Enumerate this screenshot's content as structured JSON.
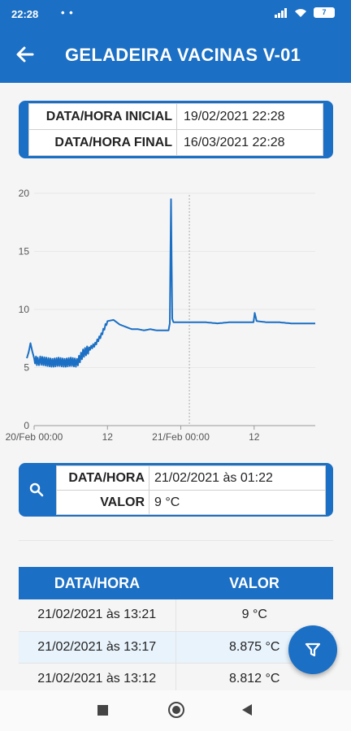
{
  "status": {
    "time": "22:28",
    "dots": "• •",
    "battery": "7"
  },
  "header": {
    "back_icon": "arrow-left-icon",
    "title": "GELADEIRA VACINAS V-01"
  },
  "range": {
    "rows": [
      {
        "label": "DATA/HORA INICIAL",
        "value": "19/02/2021 22:28"
      },
      {
        "label": "DATA/HORA FINAL",
        "value": "16/03/2021 22:28"
      }
    ]
  },
  "chart_data": {
    "type": "line",
    "ylim": [
      0,
      20
    ],
    "yticks": [
      "0",
      "5",
      "10",
      "15",
      "20"
    ],
    "xticks": [
      "20/Feb 00:00",
      "12",
      "21/Feb 00:00",
      "12"
    ],
    "xrange_hours": [
      0,
      46
    ],
    "cursor_hour": 25.4,
    "series": [
      {
        "x": [
          -1.2,
          -0.9,
          -0.6,
          -0.3,
          0,
          0.3,
          0.6,
          1,
          2,
          3,
          4,
          5,
          6,
          7,
          8,
          9,
          10,
          11,
          12,
          13,
          14,
          15,
          16,
          17,
          18,
          19,
          20,
          21,
          22,
          22.2,
          22.4,
          22.6,
          22.8,
          23,
          24,
          26,
          28,
          30,
          32,
          34,
          35.9,
          36.1,
          36.4,
          38,
          40,
          42,
          44,
          46
        ],
        "y": [
          5.8,
          6.3,
          7.1,
          6.4,
          5.8,
          5.6,
          5.5,
          5.6,
          5.5,
          5.4,
          5.5,
          5.4,
          5.5,
          5.4,
          6.2,
          6.6,
          7.0,
          7.8,
          9.0,
          9.1,
          8.7,
          8.5,
          8.3,
          8.3,
          8.2,
          8.3,
          8.2,
          8.2,
          8.2,
          8.8,
          19.5,
          9.2,
          8.9,
          8.9,
          8.9,
          8.9,
          8.9,
          8.8,
          8.9,
          8.9,
          8.9,
          9.7,
          9.0,
          8.9,
          8.9,
          8.8,
          8.8,
          8.8
        ]
      }
    ]
  },
  "selection": {
    "search_icon": "search-icon",
    "rows": [
      {
        "label": "DATA/HORA",
        "value": "21/02/2021 às 01:22"
      },
      {
        "label": "VALOR",
        "value": "9 °C"
      }
    ]
  },
  "table": {
    "headers": [
      "DATA/HORA",
      "VALOR"
    ],
    "rows": [
      {
        "date": "21/02/2021 às 13:21",
        "value": "9 °C"
      },
      {
        "date": "21/02/2021 às 13:17",
        "value": "8.875 °C"
      },
      {
        "date": "21/02/2021 às 13:12",
        "value": "8.812 °C"
      }
    ]
  },
  "fab": {
    "icon": "filter-icon"
  },
  "colors": {
    "primary": "#1b6fc4",
    "line": "#1b6fc4",
    "row_alt": "#e8f3fc"
  }
}
